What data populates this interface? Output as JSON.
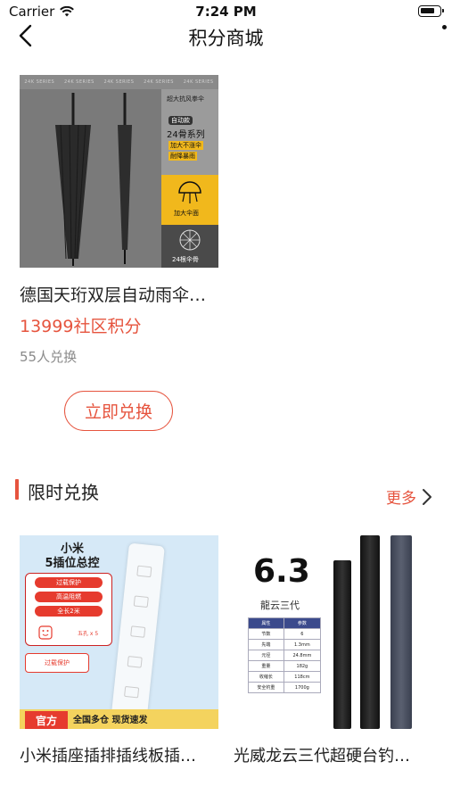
{
  "status_bar": {
    "carrier": "Carrier",
    "time": "7:24 PM",
    "icons": [
      "wifi-icon",
      "battery-icon"
    ]
  },
  "nav": {
    "title": "积分商城",
    "back_icon": "chevron-left-icon"
  },
  "featured": {
    "title": "德国天珩双层自动雨伞…",
    "price": "13999社区积分",
    "exchanged": "55人兑换",
    "button_label": "立即兑换",
    "image": {
      "series_strip": [
        "24K SERIES",
        "24K SERIES",
        "24K SERIES",
        "24K SERIES",
        "24K SERIES"
      ],
      "panel_line1": "超大抗风拳伞",
      "panel_line2": "自动款",
      "panel_line3": "24骨系列",
      "panel_line4": "加大不涨伞",
      "panel_line5": "耐降暴雨",
      "yellow_label": "加大伞面",
      "dark_label": "24根伞骨"
    }
  },
  "limited": {
    "section_title": "限时兑换",
    "more_label": "更多",
    "more_icon": "chevron-right-icon",
    "items": [
      {
        "title": "小米插座插排插线板插…",
        "image": {
          "name_line1": "小米",
          "name_line2": "5插位总控",
          "pills": [
            "过载保护",
            "高温阻燃",
            "全长2米"
          ],
          "ports": "五孔 x 5",
          "safe_label": "过载保护",
          "official": "官方",
          "footer": "全国多仓 现货速发"
        }
      },
      {
        "title": "光威龙云三代超硬台钓…",
        "image": {
          "size": "6.3",
          "name": "龍云三代",
          "table_header": [
            "属性",
            "参数"
          ],
          "table_rows": [
            [
              "节数",
              "6"
            ],
            [
              "先端",
              "1.3mm"
            ],
            [
              "元径",
              "24.8mm"
            ],
            [
              "重量",
              "182g"
            ],
            [
              "收缩长",
              "118cm"
            ],
            [
              "安全钓重",
              "1700g"
            ]
          ]
        }
      }
    ]
  },
  "colors": {
    "accent": "#e6543e",
    "text": "#222222",
    "muted": "#8a8a8a"
  }
}
